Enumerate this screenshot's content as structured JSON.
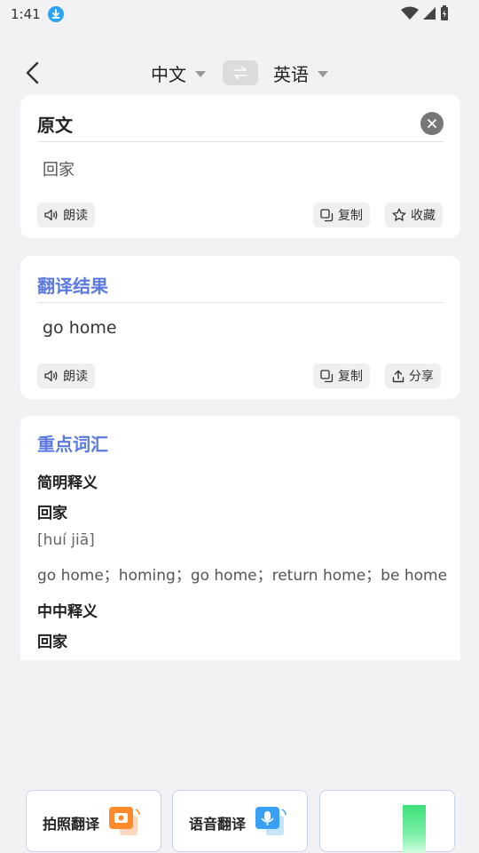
{
  "status_bar": {
    "time": "1:41"
  },
  "topbar": {
    "source_lang": "中文",
    "target_lang": "英语"
  },
  "source_card": {
    "title": "原文",
    "text": "回家",
    "read_label": "朗读",
    "copy_label": "复制",
    "favorite_label": "收藏"
  },
  "result_card": {
    "title": "翻译结果",
    "text": "go home",
    "read_label": "朗读",
    "copy_label": "复制",
    "share_label": "分享"
  },
  "vocab_card": {
    "title": "重点词汇",
    "simple_heading": "简明释义",
    "word": "回家",
    "pinyin": "[huí jiā]",
    "meanings": "go home；homing；go home；return home；be home",
    "cn_heading": "中中释义",
    "cn_word": "回家"
  },
  "bottom_bar": {
    "photo_label": "拍照翻译",
    "voice_label": "语音翻译"
  },
  "colors": {
    "accent": "#5b79e0",
    "background": "#f2f2f4",
    "orange_icon": "#ff8a2a",
    "blue_icon": "#3aa0f5",
    "green": "#3ee07a"
  },
  "icons": [
    "download-icon",
    "wifi-icon",
    "signal-icon",
    "battery-icon",
    "back-arrow-icon",
    "swap-icon",
    "clear-icon",
    "speaker-icon",
    "copy-icon",
    "star-icon",
    "share-icon",
    "camera-icon",
    "microphone-icon"
  ]
}
